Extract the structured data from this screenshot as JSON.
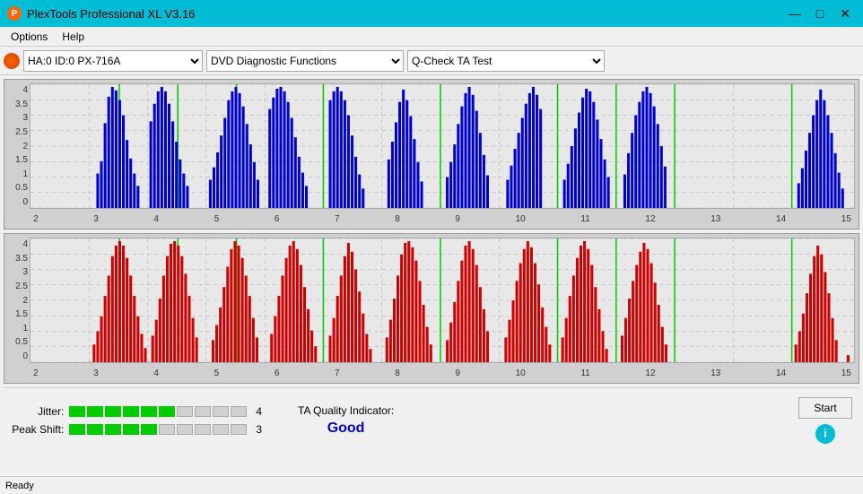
{
  "window": {
    "title": "PlexTools Professional XL V3.16",
    "icon": "P"
  },
  "titlebar": {
    "minimize": "—",
    "maximize": "□",
    "close": "✕"
  },
  "menu": {
    "items": [
      "Options",
      "Help"
    ]
  },
  "toolbar": {
    "drive": "HA:0 ID:0  PX-716A",
    "function": "DVD Diagnostic Functions",
    "test": "Q-Check TA Test"
  },
  "charts": {
    "blue": {
      "label": "Blue channel chart",
      "yLabels": [
        "4",
        "3.5",
        "3",
        "2.5",
        "2",
        "1.5",
        "1",
        "0.5",
        "0"
      ],
      "xLabels": [
        "2",
        "3",
        "4",
        "5",
        "6",
        "7",
        "8",
        "9",
        "10",
        "11",
        "12",
        "13",
        "14",
        "15"
      ]
    },
    "red": {
      "label": "Red channel chart",
      "yLabels": [
        "4",
        "3.5",
        "3",
        "2.5",
        "2",
        "1.5",
        "1",
        "0.5",
        "0"
      ],
      "xLabels": [
        "2",
        "3",
        "4",
        "5",
        "6",
        "7",
        "8",
        "9",
        "10",
        "11",
        "12",
        "13",
        "14",
        "15"
      ]
    }
  },
  "metrics": {
    "jitter": {
      "label": "Jitter:",
      "filled": 6,
      "total": 10,
      "value": "4"
    },
    "peakShift": {
      "label": "Peak Shift:",
      "filled": 5,
      "total": 10,
      "value": "3"
    }
  },
  "ta": {
    "label": "TA Quality Indicator:",
    "value": "Good"
  },
  "buttons": {
    "start": "Start"
  },
  "statusBar": {
    "text": "Ready"
  }
}
